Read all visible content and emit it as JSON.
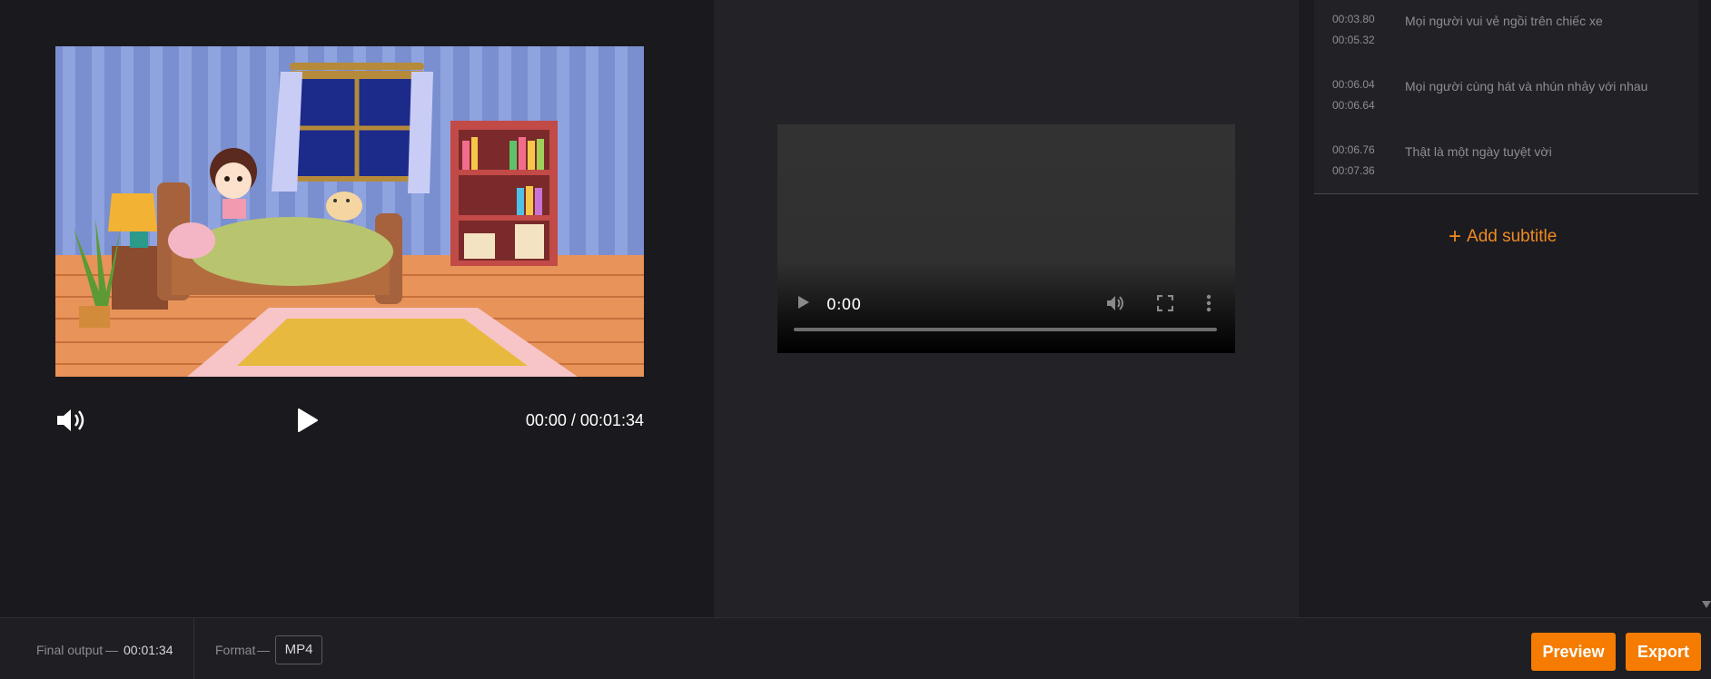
{
  "editor": {
    "timecode": "00:00 / 00:01:34",
    "video_icon": "cartoon-bedroom-thumbnail",
    "volume_icon": "speaker-volume-icon",
    "play_icon": "play-icon"
  },
  "preview": {
    "time": "0:00",
    "icons": [
      "play-icon",
      "volume-icon",
      "fullscreen-icon",
      "more-vert-icon"
    ]
  },
  "subtitles": {
    "items": [
      {
        "start": "00:03.80",
        "end": "00:05.32",
        "text": "Mọi người vui vẻ ngồi trên chiếc xe"
      },
      {
        "start": "00:06.04",
        "end": "00:06.64",
        "text": "Mọi người cùng hát và nhún nhảy với nhau"
      },
      {
        "start": "00:06.76",
        "end": "00:07.36",
        "text": "Thật là một ngày tuyệt vời"
      }
    ],
    "add_label": "Add subtitle"
  },
  "footer": {
    "final_output_label": "Final output",
    "dash": "—",
    "final_output_value": "00:01:34",
    "format_label": "Format",
    "format_value": "MP4",
    "preview_label": "Preview",
    "export_label": "Export"
  },
  "colors": {
    "accent": "#f57c00",
    "add_subtitle": "#f08a1f",
    "background": "#19191e"
  }
}
